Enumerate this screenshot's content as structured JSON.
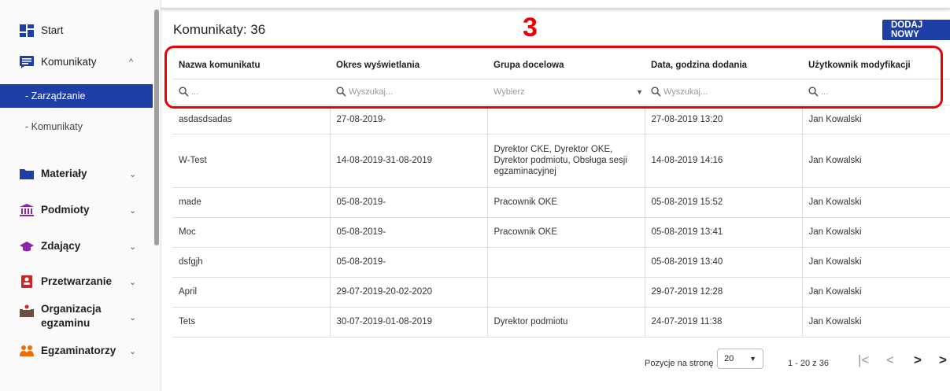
{
  "sidebar": {
    "start": "Start",
    "komunikaty": "Komunikaty",
    "zarzadzanie": "- Zarządzanie",
    "komunikaty_sub": "- Komunikaty",
    "materialy": "Materiały",
    "podmioty": "Podmioty",
    "zdajacy": "Zdający",
    "przetwarzanie": "Przetwarzanie",
    "organizacja_1": "Organizacja",
    "organizacja_2": "egzaminu",
    "egzaminatorzy": "Egzaminatorzy",
    "chevron_up": "^",
    "chevron_down": "⌄"
  },
  "header": {
    "title": "Komunikaty: 36",
    "add_button": "DODAJ NOWY",
    "annotation": "3"
  },
  "table": {
    "columns": [
      "Nazwa komunikatu",
      "Okres wyświetlania",
      "Grupa docelowa",
      "Data, godzina dodania",
      "Użytkownik modyfikacji"
    ],
    "filters": {
      "name_placeholder": "...",
      "period_placeholder": "Wyszukaj...",
      "group_placeholder": "Wybierz",
      "date_placeholder": "Wyszukaj...",
      "user_placeholder": "..."
    },
    "rows": [
      [
        "asdasdsadas",
        "27-08-2019-",
        "",
        "27-08-2019 13:20",
        "Jan Kowalski"
      ],
      [
        "W-Test",
        "14-08-2019-31-08-2019",
        "Dyrektor CKE, Dyrektor OKE, Dyrektor podmiotu, Obsługa sesji egzaminacyjnej",
        "14-08-2019 14:16",
        "Jan Kowalski"
      ],
      [
        "made",
        "05-08-2019-",
        "Pracownik OKE",
        "05-08-2019 15:52",
        "Jan Kowalski"
      ],
      [
        "Moc",
        "05-08-2019-",
        "Pracownik OKE",
        "05-08-2019 13:41",
        "Jan Kowalski"
      ],
      [
        "dsfgjh",
        "05-08-2019-",
        "",
        "05-08-2019 13:40",
        "Jan Kowalski"
      ],
      [
        "April",
        "29-07-2019-20-02-2020",
        "",
        "29-07-2019 12:28",
        "Jan Kowalski"
      ],
      [
        "Tets",
        "30-07-2019-01-08-2019",
        "Dyrektor podmiotu",
        "24-07-2019 11:38",
        "Jan Kowalski"
      ]
    ]
  },
  "pagination": {
    "label": "Pozycje na stronę",
    "page_size": "20",
    "range": "1 - 20 z 36"
  },
  "colors": {
    "primary": "#1e3fa6",
    "annotation": "#ee0000"
  }
}
